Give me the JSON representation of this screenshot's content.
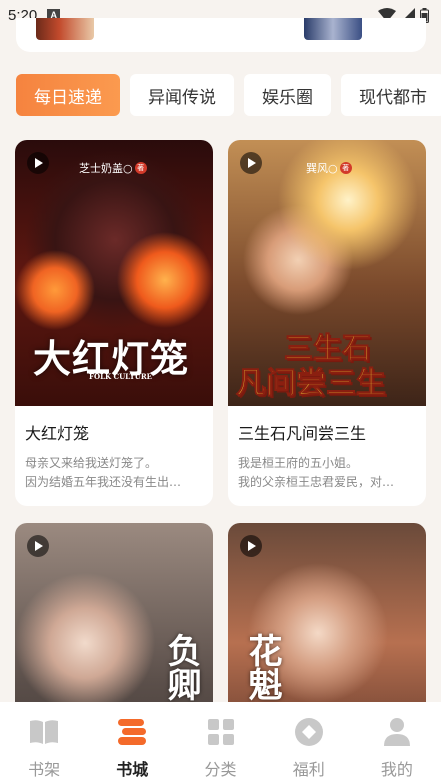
{
  "status": {
    "time": "5:20",
    "indicator": "A"
  },
  "tabs": [
    {
      "label": "每日速递",
      "active": true
    },
    {
      "label": "异闻传说",
      "active": false
    },
    {
      "label": "娱乐圈",
      "active": false
    },
    {
      "label": "现代都市",
      "active": false
    }
  ],
  "books": [
    {
      "title": "大红灯笼",
      "desc1": "母亲又来给我送灯笼了。",
      "desc2": "因为结婚五年我还没有生出…",
      "author": "芝士奶盖○",
      "badge": "著",
      "cover_title": "大红灯笼",
      "cover_sub": "FOLK CULTURE"
    },
    {
      "title": "三生石凡间尝三生",
      "desc1": "我是桓王府的五小姐。",
      "desc2": "我的父亲桓王忠君爱民，对…",
      "author": "巽风○",
      "badge": "著",
      "cover_line1": "三生石",
      "cover_line2": "凡间尝三生"
    },
    {
      "cover_vertical": "负卿"
    },
    {
      "cover_vertical": "花魁"
    }
  ],
  "nav": [
    {
      "label": "书架",
      "icon": "book-open-icon",
      "active": false
    },
    {
      "label": "书城",
      "icon": "bookstore-icon",
      "active": true
    },
    {
      "label": "分类",
      "icon": "grid-icon",
      "active": false
    },
    {
      "label": "福利",
      "icon": "gift-coin-icon",
      "active": false
    },
    {
      "label": "我的",
      "icon": "user-icon",
      "active": false
    }
  ],
  "colors": {
    "accent": "#f5833f",
    "background": "#f7f3ef"
  }
}
